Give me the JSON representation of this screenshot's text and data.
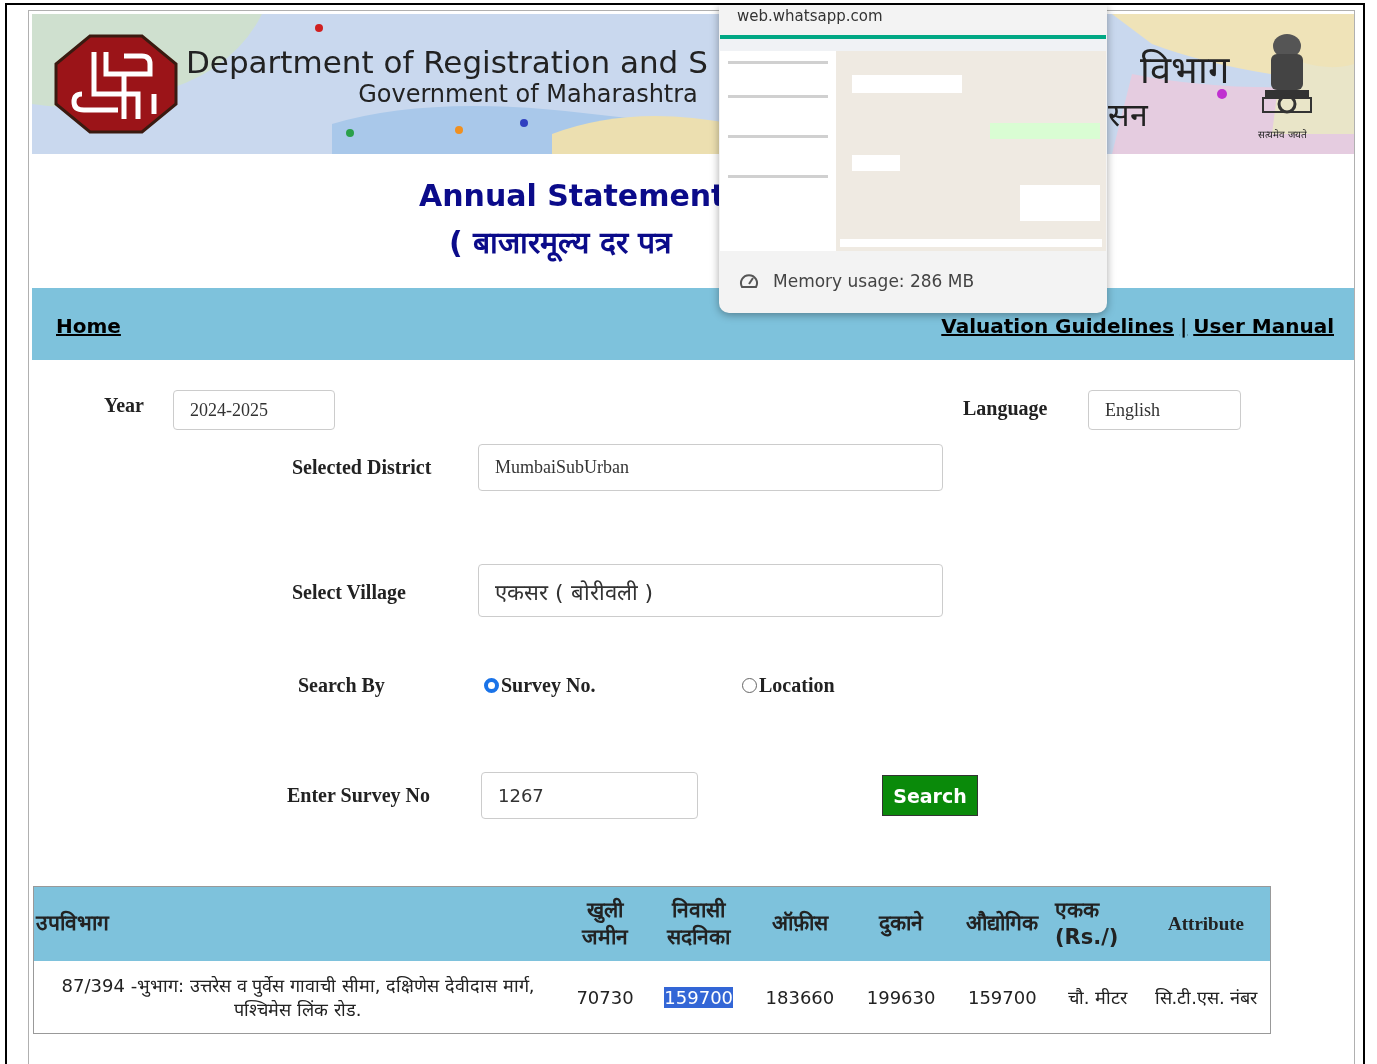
{
  "banner": {
    "title": "Department of Registration and S",
    "subtitle": "Government of Maharashtra",
    "title_right": "विभाग",
    "subtitle_right": "सन",
    "motto": "सत्यमेव जयते"
  },
  "heading": {
    "title": "Annual Statement",
    "subtitle": "( बाजारमूल्य दर पत्र"
  },
  "nav": {
    "home": "Home",
    "links": [
      "Valuation Guidelines",
      "User Manual"
    ],
    "separator": "|"
  },
  "form": {
    "year": {
      "label": "Year",
      "value": "2024-2025"
    },
    "language": {
      "label": "Language",
      "value": "English"
    },
    "district": {
      "label": "Selected District",
      "value": "MumbaiSubUrban"
    },
    "village": {
      "label": "Select Village",
      "value": "एकसर ( बोरीवली )"
    },
    "search_by": {
      "label": "Search By",
      "options": [
        {
          "label": "Survey No.",
          "selected": true
        },
        {
          "label": "Location",
          "selected": false
        }
      ]
    },
    "survey": {
      "label": "Enter Survey No",
      "value": "1267"
    },
    "search_button": "Search"
  },
  "table": {
    "columns": [
      "उपविभाग",
      "खुली\nजमीन",
      "निवासी\nसदनिका",
      "ऑफ़ीस",
      "दुकाने",
      "औद्योगिक",
      "एकक\n(Rs./)",
      "Attribute"
    ],
    "rows": [
      {
        "cells": [
          {
            "text": "87/394 -भुभाग: उत्तरेस व पुर्वेस गावाची सीमा, दक्षिणेस देवीदास मार्ग, पश्चिमेस लिंक रोड.",
            "selected": false
          },
          {
            "text": "70730",
            "selected": false
          },
          {
            "text": "159700",
            "selected": true
          },
          {
            "text": "183660",
            "selected": false
          },
          {
            "text": "199630",
            "selected": false
          },
          {
            "text": "159700",
            "selected": false
          },
          {
            "text": "चौ. मीटर",
            "selected": false
          },
          {
            "text": "सि.टी.एस. नंबर",
            "selected": false
          }
        ]
      }
    ]
  },
  "popup": {
    "url": "web.whatsapp.com",
    "memory": "Memory usage: 286 MB"
  }
}
